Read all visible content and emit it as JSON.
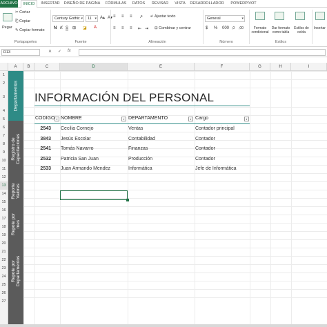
{
  "ribbon_tabs": [
    "ARCHIVO",
    "INICIO",
    "INSERTAR",
    "DISEÑO DE PÁGINA",
    "FÓRMULAS",
    "DATOS",
    "REVISAR",
    "VISTA",
    "DESARROLLADOR",
    "POWERPIVOT"
  ],
  "clipboard": {
    "paste": "Pegar",
    "cut": "Cortar",
    "copy": "Copiar",
    "format_painter": "Copiar formato",
    "group": "Portapapeles"
  },
  "font": {
    "name": "Century Gothic",
    "size": "11",
    "bold": "N",
    "italic": "K",
    "underline": "S",
    "group": "Fuente"
  },
  "alignment": {
    "wrap": "Ajustar texto",
    "merge": "Combinar y centrar",
    "group": "Alineación"
  },
  "number": {
    "format": "General",
    "group": "Número"
  },
  "styles": {
    "cond_format": "Formato condicional",
    "table_format": "Dar formato como tabla",
    "cell_styles": "Estilos de celda",
    "group": "Estilos"
  },
  "cells": {
    "insert": "Insertar"
  },
  "formula_bar": {
    "name_box": "D13",
    "cancel": "✕",
    "enter": "✓",
    "fx": "fx",
    "content": ""
  },
  "columns": [
    "A",
    "B",
    "C",
    "D",
    "E",
    "F",
    "G",
    "H",
    "I"
  ],
  "rows": [
    "1",
    "2",
    "3",
    "4",
    "5",
    "6",
    "7",
    "8",
    "9",
    "10",
    "11",
    "12",
    "13",
    "14",
    "15",
    "16",
    "17",
    "18",
    "19",
    "20",
    "21",
    "22",
    "23",
    "24",
    "25",
    "26",
    "27"
  ],
  "side_nav": [
    {
      "label": "Departamentos",
      "active": true
    },
    {
      "label": "Registro de Capacitaciones",
      "active": false
    },
    {
      "label": "Reporte Valores",
      "active": false
    },
    {
      "label": "Repote por mes",
      "active": false
    },
    {
      "label": "Repote por Departamentos",
      "active": false
    }
  ],
  "sheet": {
    "title": "INFORMACIÓN DEL PERSONAL",
    "headers": [
      "CODIGO",
      "NOMBRE",
      "DEPARTAMENTO",
      "Cargo"
    ],
    "records": [
      {
        "code": "2543",
        "name": "Cecilia Cornejo",
        "dept": "Ventas",
        "role": "Contador principal"
      },
      {
        "code": "3843",
        "name": "Jesús Escolar",
        "dept": "Contabilidad",
        "role": "Contador"
      },
      {
        "code": "2541",
        "name": "Tomás Navarro",
        "dept": "Finanzas",
        "role": "Contador"
      },
      {
        "code": "2532",
        "name": "Patricia San Juan",
        "dept": "Producción",
        "role": "Contador"
      },
      {
        "code": "2533",
        "name": "Juan Armando Mendez",
        "dept": "Informática",
        "role": "Jefe de Informática"
      }
    ]
  },
  "colors": {
    "accent": "#217346",
    "table_line": "#2e8b86",
    "nav_bg": "#5b5b5b",
    "nav_active": "#2e8b86"
  }
}
